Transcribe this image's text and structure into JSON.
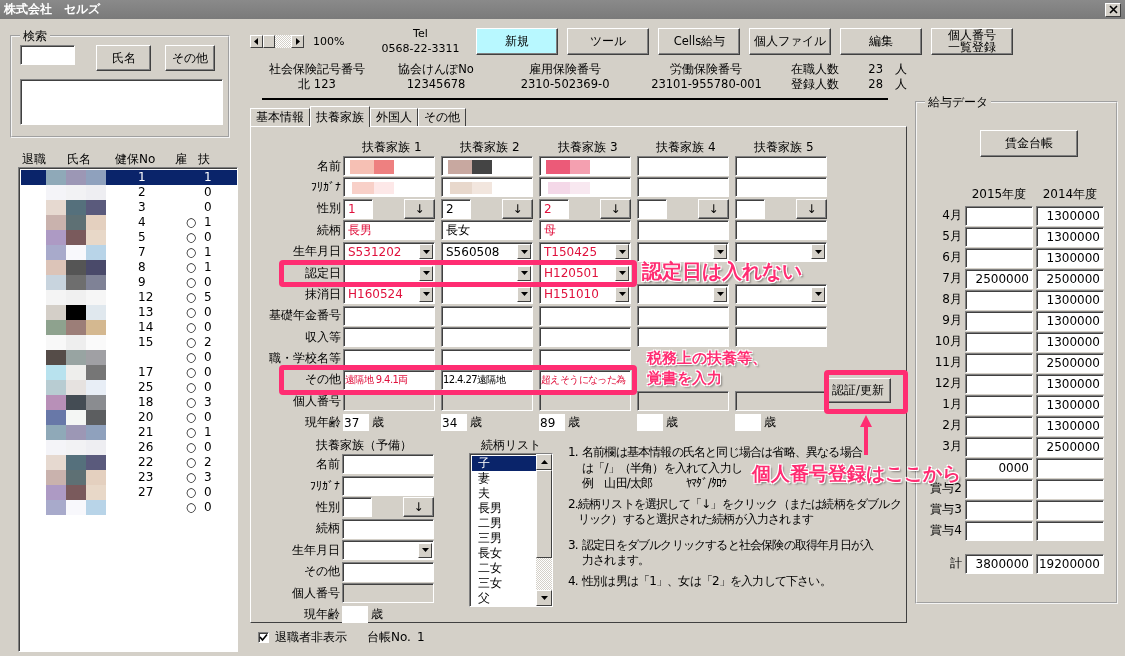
{
  "window": {
    "title": "株式会社　セルズ"
  },
  "search": {
    "legend": "検索",
    "buttons": [
      "氏名",
      "その他"
    ]
  },
  "employee_list": {
    "columns": [
      "退職",
      "氏名",
      "健保No",
      "雇",
      "扶"
    ],
    "rows": [
      {
        "no": "1",
        "dependents": "1",
        "selected": true
      },
      {
        "no": "2",
        "dependents": "0",
        "selected": false
      },
      {
        "no": "3",
        "dependents": "0",
        "selected": false
      },
      {
        "no": "4",
        "employed": "○",
        "dependents": "1",
        "selected": false
      },
      {
        "no": "5",
        "employed": "○",
        "dependents": "0",
        "selected": false
      },
      {
        "no": "7",
        "employed": "○",
        "dependents": "1",
        "selected": false
      },
      {
        "no": "8",
        "employed": "○",
        "dependents": "1",
        "selected": false
      },
      {
        "no": "9",
        "employed": "○",
        "dependents": "0",
        "selected": false
      },
      {
        "no": "12",
        "employed": "○",
        "dependents": "5",
        "selected": false
      },
      {
        "no": "13",
        "employed": "○",
        "dependents": "0",
        "selected": false
      },
      {
        "no": "14",
        "employed": "○",
        "dependents": "0",
        "selected": false
      },
      {
        "no": "15",
        "employed": "○",
        "dependents": "2",
        "selected": false
      },
      {
        "employed": "○",
        "dependents": "0",
        "selected": false
      },
      {
        "no": "17",
        "employed": "○",
        "dependents": "0",
        "selected": false
      },
      {
        "no": "25",
        "employed": "○",
        "dependents": "0",
        "selected": false
      },
      {
        "no": "18",
        "employed": "○",
        "dependents": "3",
        "selected": false
      },
      {
        "no": "20",
        "employed": "○",
        "dependents": "0",
        "selected": false
      },
      {
        "no": "21",
        "employed": "○",
        "dependents": "1",
        "selected": false
      },
      {
        "no": "26",
        "employed": "○",
        "dependents": "0",
        "selected": false
      },
      {
        "no": "22",
        "employed": "○",
        "dependents": "2",
        "selected": false
      },
      {
        "no": "23",
        "employed": "○",
        "dependents": "3",
        "selected": false
      },
      {
        "no": "27",
        "employed": "○",
        "dependents": "0",
        "selected": false
      },
      {
        "employed": "○",
        "dependents": "0",
        "selected": false
      }
    ]
  },
  "toolbar": {
    "zoom": "100%",
    "tel_label": "Tel",
    "tel": "0568-22-3311",
    "buttons": [
      {
        "lines": [
          "新規"
        ],
        "highlighted": true
      },
      {
        "lines": [
          "ツール"
        ],
        "highlighted": false
      },
      {
        "lines": [
          "Cells給与"
        ],
        "highlighted": false
      },
      {
        "lines": [
          "個人ファイル"
        ],
        "highlighted": false
      },
      {
        "lines": [
          "編集"
        ],
        "highlighted": false
      },
      {
        "lines": [
          "個人番号",
          "一覧登録"
        ],
        "highlighted": false
      }
    ]
  },
  "info": [
    {
      "label": "社会保険記号番号",
      "value": "北 123"
    },
    {
      "label": "協会けんぽNo",
      "value": "12345678"
    },
    {
      "label": "雇用保険番号",
      "value": "2310-502369-0"
    },
    {
      "label": "労働保険番号",
      "value": "23101-955780-001"
    }
  ],
  "counts": [
    {
      "label": "在職人数",
      "value": "23",
      "unit": "人"
    },
    {
      "label": "登録人数",
      "value": "28",
      "unit": "人"
    }
  ],
  "tabs": [
    {
      "label": "基本情報",
      "selected": false
    },
    {
      "label": "扶養家族",
      "selected": true
    },
    {
      "label": "外国人",
      "selected": false
    },
    {
      "label": "その他",
      "selected": false
    }
  ],
  "form": {
    "row_labels": [
      "名前",
      "ﾌﾘｶﾞﾅ",
      "性別",
      "続柄",
      "生年月日",
      "認定日",
      "抹消日",
      "基礎年金番号",
      "収入等",
      "職・学校名等",
      "その他",
      "個人番号",
      "現年齢"
    ],
    "members": [
      {
        "title": "扶養家族 1",
        "highlighted": true,
        "name_hidden": true,
        "furigana_hidden": true,
        "gender": "1",
        "gender_button": "↓",
        "relation": "長男",
        "birth": "S531202",
        "removed": "H160524",
        "other": "遠隔地 9.4.1両",
        "age": "37",
        "age_unit": "歳"
      },
      {
        "title": "扶養家族 2",
        "highlighted": false,
        "name_hidden": true,
        "furigana_hidden": true,
        "gender": "2",
        "gender_button": "↓",
        "relation": "長女",
        "birth": "S560508",
        "other": "12.4.27遠隔地",
        "age": "34",
        "age_unit": "歳"
      },
      {
        "title": "扶養家族 3",
        "highlighted": true,
        "name_hidden": true,
        "furigana_hidden": true,
        "gender": "2",
        "gender_button": "↓",
        "relation": "母",
        "birth": "T150425",
        "certified": "H120501",
        "removed": "H151010",
        "other": "超えそうになった為",
        "age": "89",
        "age_unit": "歳"
      },
      {
        "title": "扶養家族 4",
        "name_hidden": false,
        "furigana_hidden": false,
        "gender_button": "↓",
        "age_unit": "歳"
      },
      {
        "title": "扶養家族 5",
        "name_hidden": false,
        "furigana_hidden": false,
        "gender_button": "↓",
        "age_unit": "歳"
      }
    ],
    "confirm_button": "認証/更新"
  },
  "reserve": {
    "title": "扶養家族（予備）",
    "labels": [
      "名前",
      "ﾌﾘｶﾞﾅ",
      "性別",
      "続柄",
      "生年月日",
      "その他",
      "個人番号",
      "現年齢"
    ],
    "gender_button": "↓",
    "age_unit": "歳"
  },
  "relation_list": {
    "title": "続柄リスト",
    "items": [
      {
        "label": "子",
        "selected": true
      },
      {
        "label": "妻",
        "selected": false
      },
      {
        "label": "夫",
        "selected": false
      },
      {
        "label": "長男",
        "selected": false
      },
      {
        "label": "二男",
        "selected": false
      },
      {
        "label": "三男",
        "selected": false
      },
      {
        "label": "長女",
        "selected": false
      },
      {
        "label": "二女",
        "selected": false
      },
      {
        "label": "三女",
        "selected": false
      },
      {
        "label": "父",
        "selected": false
      }
    ]
  },
  "notes": [
    {
      "number": "1.",
      "lines": [
        "名前欄は基本情報の氏名と同じ場合は省略、異なる場合",
        "は「/」（半角）を入れて入力し",
        "例　山田/太郎　　　ﾔﾏﾀﾞ/ﾀﾛｳ"
      ]
    },
    {
      "number": "2.",
      "lines": [
        "続柄リストを選択して「↓」をクリック（または続柄をダブルク",
        "リック）すると選択された続柄が入力されます"
      ]
    },
    {
      "number": "3.",
      "lines": [
        "認定日をダブルクリックすると社会保険の取得年月日が入",
        "力されます。"
      ]
    },
    {
      "number": "4.",
      "lines": [
        "性別は男は「1」、女は「2」を入力して下さい。"
      ]
    }
  ],
  "salary": {
    "legend": "給与データ",
    "ledger_button": "賃金台帳",
    "years": [
      "2015年度",
      "2014年度"
    ],
    "rows": [
      {
        "label": "4月",
        "previous": "1300000"
      },
      {
        "label": "5月",
        "previous": "1300000"
      },
      {
        "label": "6月",
        "previous": "1300000"
      },
      {
        "label": "7月",
        "current": "2500000",
        "previous": "2500000"
      },
      {
        "label": "8月",
        "previous": "1300000"
      },
      {
        "label": "9月",
        "previous": "1300000"
      },
      {
        "label": "10月",
        "previous": "1300000"
      },
      {
        "label": "11月",
        "previous": "2500000"
      },
      {
        "label": "12月",
        "previous": "1300000"
      },
      {
        "label": "1月",
        "previous": "1300000"
      },
      {
        "label": "2月",
        "previous": "1300000"
      },
      {
        "label": "3月",
        "previous": "2500000"
      },
      {
        "current": "0000"
      },
      {
        "label": "賞与2"
      },
      {
        "label": "賞与3"
      },
      {
        "label": "賞与4"
      }
    ],
    "total": {
      "label": "計",
      "current": "3800000",
      "previous": "19200000"
    }
  },
  "footer": {
    "checkbox": {
      "label": "退職者非表示",
      "checked": true
    },
    "ledger_label": "台帳No.",
    "ledger_no": "1"
  },
  "annotations": [
    {
      "lines": [
        "認定日は入れない"
      ]
    },
    {
      "lines": [
        "税務上の扶養等、",
        "覚書を入力"
      ]
    },
    {
      "lines": [
        "個人番号登録はここから"
      ]
    }
  ]
}
